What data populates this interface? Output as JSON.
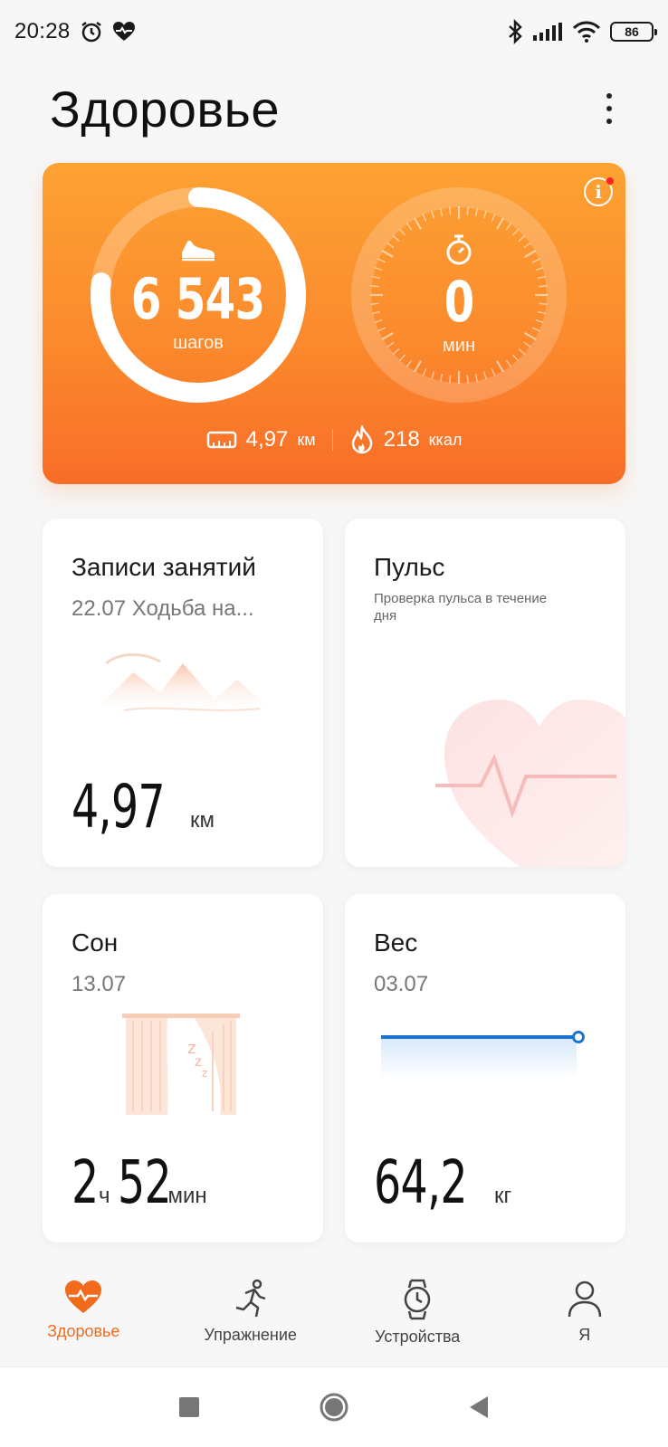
{
  "status_bar": {
    "time": "20:28",
    "battery": "86",
    "icons": [
      "alarm-icon",
      "heart-pulse-icon",
      "bluetooth-icon",
      "signal-icon",
      "wifi-icon",
      "battery-icon"
    ]
  },
  "header": {
    "title": "Здоровье"
  },
  "activity": {
    "steps_value": "6 543",
    "steps_unit": "шагов",
    "minutes_value": "0",
    "minutes_unit": "мин",
    "steps_progress": 0.77,
    "distance_value": "4,97",
    "distance_unit": "км",
    "calories_value": "218",
    "calories_unit": "ккал",
    "colors": {
      "gradient_top": "#fda233",
      "gradient_bottom": "#f86d28"
    }
  },
  "cards": {
    "workouts": {
      "title": "Записи занятий",
      "subtitle": "22.07 Ходьба на...",
      "value": "4,97",
      "unit": "км"
    },
    "pulse": {
      "title": "Пульс",
      "subtitle": "Проверка пульса в течение дня"
    },
    "sleep": {
      "title": "Сон",
      "subtitle": "13.07",
      "hours": "2",
      "hours_unit": "ч",
      "minutes": "52",
      "minutes_unit": "мин"
    },
    "weight": {
      "title": "Вес",
      "subtitle": "03.07",
      "value": "64,2",
      "unit": "кг"
    }
  },
  "bottom_nav": {
    "items": [
      {
        "label": "Здоровье",
        "icon": "heart-icon",
        "active": true
      },
      {
        "label": "Упражнение",
        "icon": "running-icon",
        "active": false
      },
      {
        "label": "Устройства",
        "icon": "watch-icon",
        "active": false
      },
      {
        "label": "Я",
        "icon": "person-icon",
        "active": false
      }
    ]
  },
  "accent_color": "#f26b1d"
}
